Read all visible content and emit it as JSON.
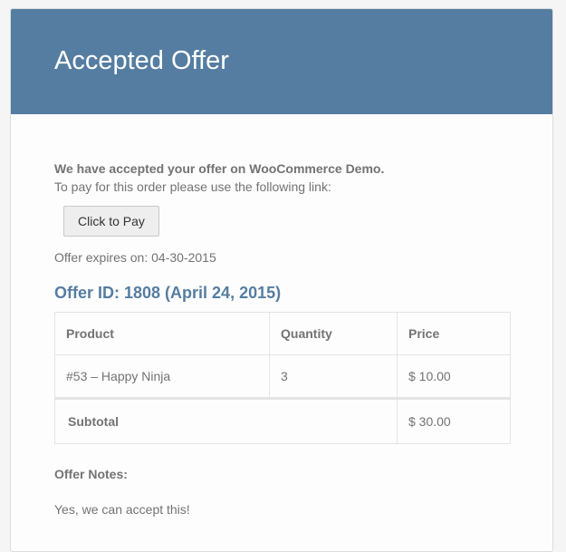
{
  "header": {
    "title": "Accepted Offer"
  },
  "body": {
    "intro_bold": "We have accepted your offer on WooCommerce Demo.",
    "intro_text": "To pay for this order please use the following link:",
    "pay_button_label": "Click to Pay",
    "expires_text": "Offer expires on: 04-30-2015",
    "offer_heading": "Offer ID: 1808 (April 24, 2015)"
  },
  "table": {
    "headers": {
      "product": "Product",
      "quantity": "Quantity",
      "price": "Price"
    },
    "rows": [
      {
        "product": "#53 – Happy Ninja",
        "quantity": "3",
        "price": "$ 10.00"
      }
    ],
    "subtotal_label": "Subtotal",
    "subtotal_value": "$ 30.00"
  },
  "notes": {
    "title": "Offer Notes:",
    "text": "Yes, we can accept this!"
  },
  "colors": {
    "header_bg": "#557da1",
    "heading_text": "#557da1",
    "body_text": "#737373"
  }
}
